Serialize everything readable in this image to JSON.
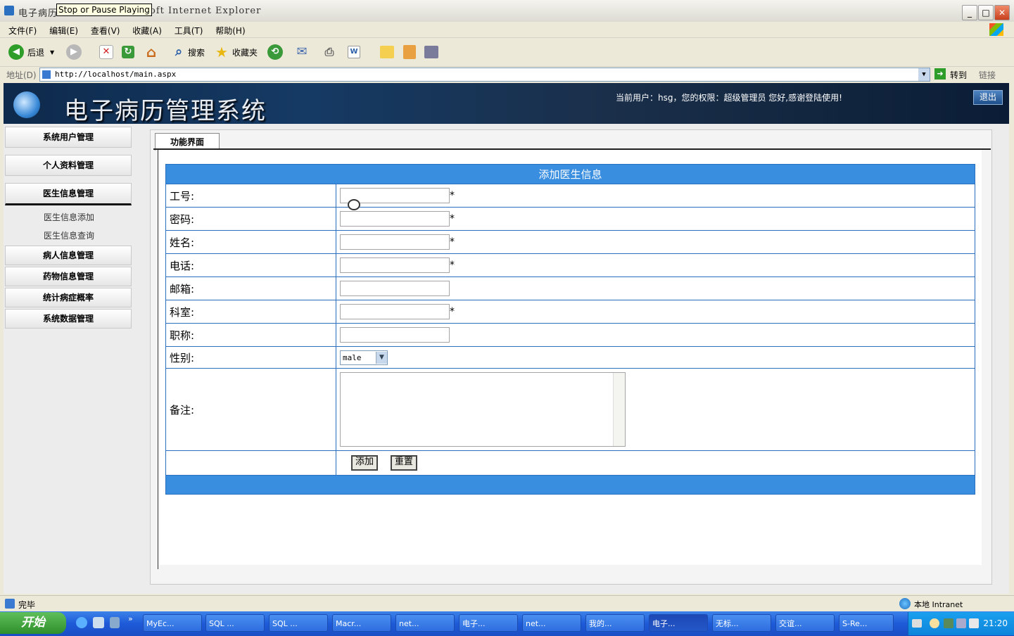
{
  "window": {
    "title": "电子病历管理系统 - Microsoft Internet Explorer",
    "title_visible_left": "电子病历",
    "title_visible_right": "oft Internet Explorer",
    "tooltip": "Stop or Pause Playing",
    "buttons": {
      "minimize": "_",
      "maximize": "□",
      "close": "✕"
    }
  },
  "menu": [
    "文件(F)",
    "编辑(E)",
    "查看(V)",
    "收藏(A)",
    "工具(T)",
    "帮助(H)"
  ],
  "toolbar": {
    "back": "后退",
    "search": "搜索",
    "favorites": "收藏夹"
  },
  "address": {
    "label": "地址(D)",
    "url": "http://localhost/main.aspx",
    "go": "转到",
    "links": "链接"
  },
  "app": {
    "title": "电子病历管理系统",
    "user_info": "当前用户：hsg，您的权限：超级管理员  您好,感谢登陆使用!",
    "logout": "退出"
  },
  "sidebar": {
    "items": [
      {
        "label": "系统用户管理"
      },
      {
        "label": "个人资料管理"
      },
      {
        "label": "医生信息管理",
        "subitems": [
          "医生信息添加",
          "医生信息查询"
        ]
      },
      {
        "label": "病人信息管理"
      },
      {
        "label": "药物信息管理"
      },
      {
        "label": "统计病症概率"
      },
      {
        "label": "系统数据管理"
      }
    ]
  },
  "content": {
    "tab": "功能界面",
    "form": {
      "title": "添加医生信息",
      "fields": [
        {
          "label": "工号:",
          "value": "",
          "required": "*"
        },
        {
          "label": "密码:",
          "value": "",
          "required": "*"
        },
        {
          "label": "姓名:",
          "value": "",
          "required": "*"
        },
        {
          "label": "电话:",
          "value": "",
          "required": "*"
        },
        {
          "label": "邮箱:",
          "value": "",
          "required": ""
        },
        {
          "label": "科室:",
          "value": "",
          "required": "*"
        },
        {
          "label": "职称:",
          "value": "",
          "required": ""
        }
      ],
      "gender": {
        "label": "性别:",
        "selected": "male"
      },
      "remark": {
        "label": "备注:",
        "value": ""
      },
      "buttons": {
        "add": "添加",
        "reset": "重置"
      }
    }
  },
  "status": {
    "text": "完毕",
    "zone": "本地 Intranet"
  },
  "taskbar": {
    "start": "开始",
    "tasks": [
      "MyEc...",
      "SQL ...",
      "SQL ...",
      "Macr...",
      "net...",
      "电子...",
      "net...",
      "我的...",
      "电子...",
      "无标...",
      "交谊...",
      "S-Re..."
    ],
    "active_index": 8,
    "clock": "21:20"
  }
}
